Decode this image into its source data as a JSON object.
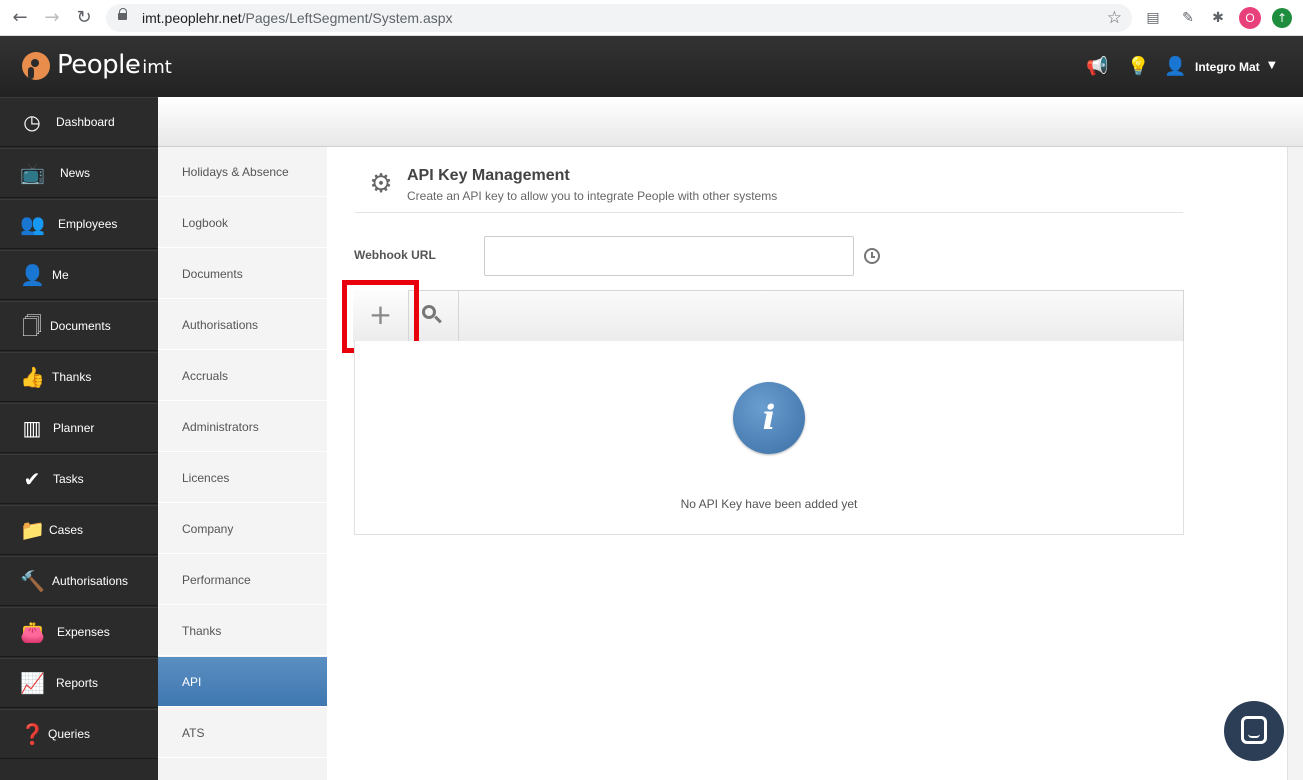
{
  "browser": {
    "url_host": "imt.peoplehr.net",
    "url_path": "/Pages/LeftSegment/System.aspx"
  },
  "header": {
    "logo_text": "People",
    "logo_sub": "- imt",
    "user_name": "Integro Mat"
  },
  "left_nav": {
    "items": [
      {
        "label": "Dashboard",
        "icon": "dashboard-icon"
      },
      {
        "label": "News",
        "icon": "tv-icon"
      },
      {
        "label": "Employees",
        "icon": "users-icon"
      },
      {
        "label": "Me",
        "icon": "user-star-icon"
      },
      {
        "label": "Documents",
        "icon": "documents-icon"
      },
      {
        "label": "Thanks",
        "icon": "thumbs-up-icon"
      },
      {
        "label": "Planner",
        "icon": "planner-icon"
      },
      {
        "label": "Tasks",
        "icon": "check-icon"
      },
      {
        "label": "Cases",
        "icon": "folder-icon"
      },
      {
        "label": "Authorisations",
        "icon": "gavel-icon"
      },
      {
        "label": "Expenses",
        "icon": "wallet-icon"
      },
      {
        "label": "Reports",
        "icon": "chart-icon"
      },
      {
        "label": "Queries",
        "icon": "question-doc-icon"
      }
    ]
  },
  "sub_nav": {
    "items": [
      {
        "label": "Holidays & Absence"
      },
      {
        "label": "Logbook"
      },
      {
        "label": "Documents"
      },
      {
        "label": "Authorisations"
      },
      {
        "label": "Accruals"
      },
      {
        "label": "Administrators"
      },
      {
        "label": "Licences"
      },
      {
        "label": "Company"
      },
      {
        "label": "Performance"
      },
      {
        "label": "Thanks"
      },
      {
        "label": "API",
        "active": true
      },
      {
        "label": "ATS"
      }
    ]
  },
  "main": {
    "title": "API Key Management",
    "subtitle": "Create an API key to allow you to integrate People with other systems",
    "webhook_label": "Webhook URL",
    "webhook_value": "",
    "add_label": "+",
    "empty_message": "No API Key have been added yet",
    "info_glyph": "i"
  },
  "colors": {
    "header_bg": "#2b2b2b",
    "active_sub": "#4a83bb",
    "highlight": "#e8000d",
    "brand_orange": "#e88d4b"
  }
}
